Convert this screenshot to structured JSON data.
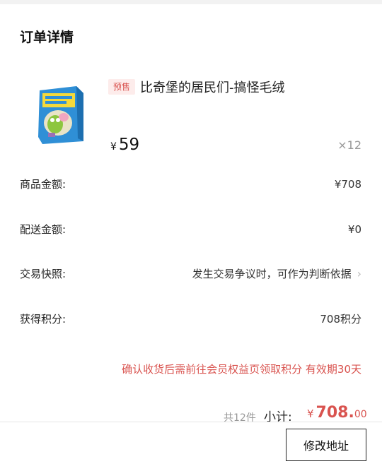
{
  "order": {
    "title": "订单详情",
    "product": {
      "presale_tag": "预售",
      "name": "比奇堡的居民们-搞怪毛绒",
      "currency": "¥",
      "price": "59",
      "quantity": "×12",
      "image_icon": "toy-box-image"
    },
    "rows": [
      {
        "label": "商品金额:",
        "value": "¥708"
      },
      {
        "label": "配送金额:",
        "value": "¥0"
      },
      {
        "label": "交易快照:",
        "value": "发生交易争议时，可作为判断依据"
      },
      {
        "label": "获得积分:",
        "value": "708积分"
      }
    ],
    "notice": "确认收货后需前往会员权益页领取积分 有效期30天"
  },
  "footer": {
    "count": "共12件",
    "subtotal_label": "小计:",
    "currency": "¥",
    "subtotal_integer": "708.",
    "subtotal_decimal": "00",
    "button": "修改地址"
  },
  "colors": {
    "accent": "#d9534f",
    "tag_bg": "#fdeceb"
  }
}
